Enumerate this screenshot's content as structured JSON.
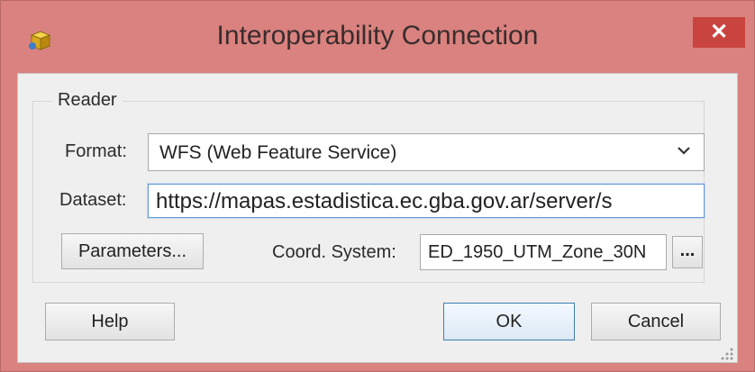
{
  "window": {
    "title": "Interoperability Connection",
    "close_label": "✕"
  },
  "reader": {
    "group_label": "Reader",
    "format_label": "Format:",
    "format_value": "WFS (Web Feature Service)",
    "dataset_label": "Dataset:",
    "dataset_value": "https://mapas.estadistica.ec.gba.gov.ar/server/s",
    "parameters_label": "Parameters...",
    "coord_label": "Coord. System:",
    "coord_value": "ED_1950_UTM_Zone_30N",
    "coord_browse_label": "..."
  },
  "footer": {
    "help_label": "Help",
    "ok_label": "OK",
    "cancel_label": "Cancel"
  },
  "colors": {
    "frame": "#d9827f",
    "close": "#c9443f",
    "focus_border": "#6a9bd6"
  },
  "icons": {
    "app": "interoperability-connection-icon",
    "dropdown": "chevron-down-icon",
    "close": "close-icon",
    "resize": "resize-grip-icon"
  }
}
